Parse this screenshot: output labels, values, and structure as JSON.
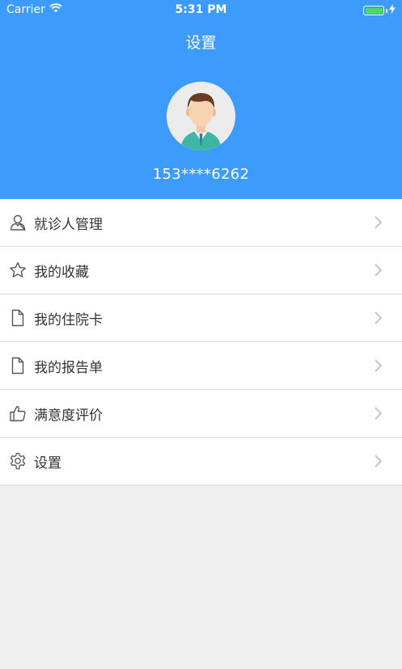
{
  "status_bar": {
    "carrier": "Carrier",
    "time": "5:31 PM"
  },
  "header": {
    "title": "设置",
    "phone": "153****6262"
  },
  "menu": {
    "items": [
      {
        "label": "就诊人管理",
        "icon": "patient-icon"
      },
      {
        "label": "我的收藏",
        "icon": "star-icon"
      },
      {
        "label": "我的住院卡",
        "icon": "document-icon"
      },
      {
        "label": "我的报告单",
        "icon": "document-icon"
      },
      {
        "label": "满意度评价",
        "icon": "thumbs-up-icon"
      },
      {
        "label": "设置",
        "icon": "gear-icon"
      }
    ]
  },
  "colors": {
    "header_bg": "#3d9bfb",
    "battery": "#4cd964",
    "page_bg": "#efefef"
  }
}
